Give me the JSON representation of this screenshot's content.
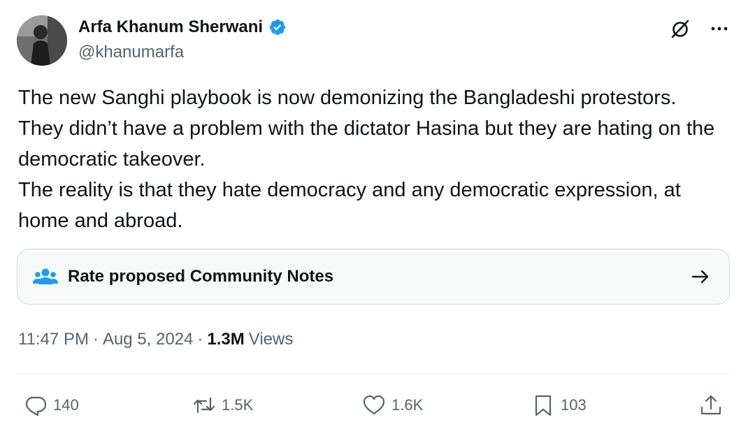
{
  "author": {
    "display_name": "Arfa Khanum Sherwani",
    "handle": "@khanumarfa",
    "avatar_icon": "profile-photo"
  },
  "tweet": {
    "text": "The new Sanghi playbook is now demonizing the Bangladeshi protestors.\nThey didn’t have a problem with the dictator Hasina but they are hating on the democratic takeover.\nThe reality is that they hate democracy and any democratic expression, at home and abroad."
  },
  "community_notes": {
    "label": "Rate proposed Community Notes",
    "icon": "people-icon"
  },
  "meta": {
    "time": "11:47 PM",
    "sep1": "·",
    "date": "Aug 5, 2024",
    "sep2": "·",
    "views_count": "1.3M",
    "views_label": "Views"
  },
  "actions": {
    "replies": "140",
    "reposts": "1.5K",
    "likes": "1.6K",
    "bookmarks": "103"
  },
  "colors": {
    "text": "#0f1419",
    "muted": "#536471",
    "verified": "#1d9bf0",
    "notes_icon": "#1d9bf0",
    "border": "#cfd9de"
  }
}
